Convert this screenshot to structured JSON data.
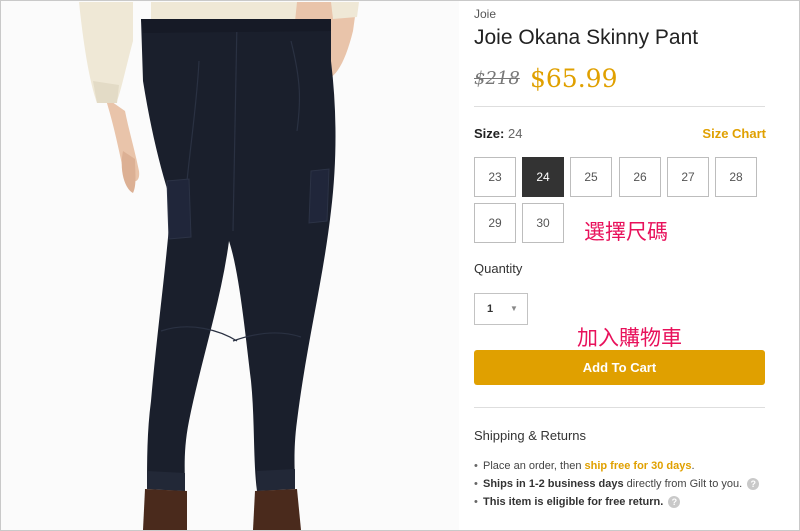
{
  "product": {
    "brand": "Joie",
    "title": "Joie Okana Skinny Pant",
    "original_price": "$218",
    "sale_price": "$65.99"
  },
  "size": {
    "label": "Size:",
    "selected_value": "24",
    "chart_link": "Size Chart",
    "options": [
      "23",
      "24",
      "25",
      "26",
      "27",
      "28",
      "29",
      "30"
    ],
    "annotation": "選擇尺碼"
  },
  "quantity": {
    "label": "Quantity",
    "value": "1"
  },
  "cart": {
    "annotation": "加入購物車",
    "button_label": "Add To Cart"
  },
  "shipping": {
    "title": "Shipping & Returns",
    "items": [
      {
        "pre": "Place an order, then ",
        "highlight": "ship free for 30 days",
        "post": "."
      },
      {
        "bold": "Ships in 1-2 business days",
        "post": " directly from Gilt to you."
      },
      {
        "bold": "This item is eligible for free return."
      }
    ]
  },
  "colors": {
    "accent": "#e0a000",
    "annotation": "#e8115b",
    "selected_size": "#333333",
    "pants": "#1a1f2c"
  },
  "icons": {
    "dropdown": "chevron-down-icon",
    "help": "question-circle-icon"
  }
}
